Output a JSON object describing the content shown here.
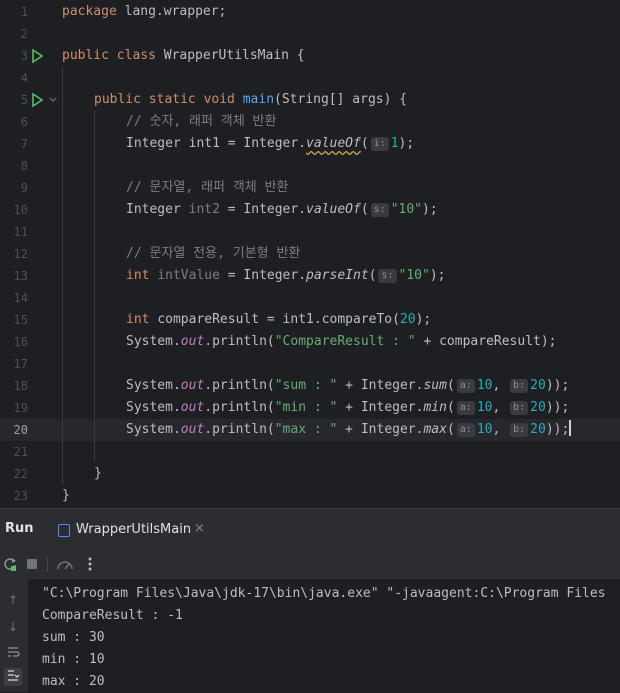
{
  "editor": {
    "current_line": 20,
    "line_numbers": [
      "1",
      "2",
      "3",
      "4",
      "5",
      "6",
      "7",
      "8",
      "9",
      "10",
      "11",
      "12",
      "13",
      "14",
      "15",
      "16",
      "17",
      "18",
      "19",
      "20",
      "21",
      "22",
      "23"
    ],
    "l1": {
      "kw": "package",
      "rest": " lang.wrapper;"
    },
    "l3": {
      "kw": "public class",
      "cls": " WrapperUtilsMain {"
    },
    "l5": {
      "kw": "public static void",
      "fn": "main",
      "rest": "(String[] args) {"
    },
    "l6": "// 숫자, 래퍼 객체 반환",
    "l7": {
      "a": "Integer int1 = Integer.",
      "call": "valueOf",
      "b": "(",
      "hint": "i:",
      "num": "1",
      "c": ");"
    },
    "l9": "// 문자열, 래퍼 객체 반환",
    "l10": {
      "a": "Integer ",
      "var": "int2",
      "b": " = Integer.",
      "call": "valueOf",
      "c": "(",
      "hint": "s:",
      "str": "\"10\"",
      "d": ");"
    },
    "l12": "// 문자열 전용, 기본형 반환",
    "l13": {
      "kw": "int ",
      "var": "intValue",
      "b": " = Integer.",
      "call": "parseInt",
      "c": "(",
      "hint": "s:",
      "str": "\"10\"",
      "d": ");"
    },
    "l15": {
      "kw": "int ",
      "a": "compareResult = int1.compareTo(",
      "num": "20",
      "c": ");"
    },
    "l16": {
      "a": "System.",
      "field": "out",
      "b": ".println(",
      "str": "\"CompareResult : \"",
      "c": " + compareResult);"
    },
    "l18": {
      "a": "System.",
      "field": "out",
      "b": ".println(",
      "str": "\"sum : \"",
      "c": " + Integer.",
      "call": "sum",
      "d": "(",
      "h1": "a:",
      "n1": "10",
      "e": ", ",
      "h2": "b:",
      "n2": "20",
      "f": "));"
    },
    "l19": {
      "a": "System.",
      "field": "out",
      "b": ".println(",
      "str": "\"min : \"",
      "c": " + Integer.",
      "call": "min",
      "d": "(",
      "h1": "a:",
      "n1": "10",
      "e": ", ",
      "h2": "b:",
      "n2": "20",
      "f": "));"
    },
    "l20": {
      "a": "System.",
      "field": "out",
      "b": ".println(",
      "str": "\"max : \"",
      "c": " + Integer.",
      "call": "max",
      "d": "(",
      "h1": "a:",
      "n1": "10",
      "e": ", ",
      "h2": "b:",
      "n2": "20",
      "f": "));"
    },
    "l22": "}",
    "l23": "}"
  },
  "run_panel": {
    "label": "Run",
    "tab_title": "WrapperUtilsMain",
    "tab_close": "×",
    "output": [
      "\"C:\\Program Files\\Java\\jdk-17\\bin\\java.exe\" \"-javaagent:C:\\Program Files",
      "CompareResult : -1",
      "sum : 30",
      "min : 10",
      "max : 20"
    ]
  },
  "icons": {
    "run": "run-gutter-icon",
    "rerun": "rerun-icon",
    "stop": "stop-icon",
    "more": "more-icon"
  },
  "colors": {
    "keyword": "#cf8e6d",
    "function": "#56a8f5",
    "comment": "#7a7e85",
    "number": "#2aacb8",
    "string": "#6aab73",
    "static_field": "#c77dbb",
    "run_icon": "#5fb865",
    "tab_underline": "#4a88e9"
  }
}
